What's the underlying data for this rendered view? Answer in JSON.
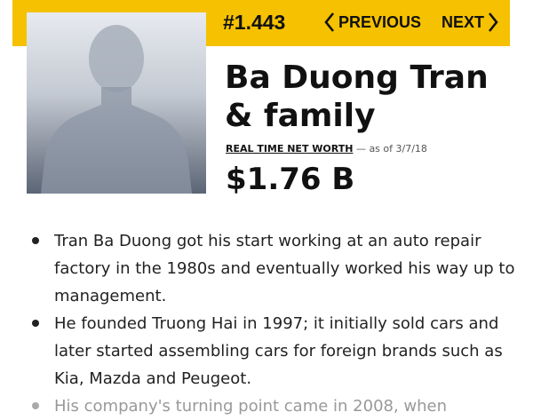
{
  "header": {
    "rank": "#1.443",
    "prev_label": "PREVIOUS",
    "next_label": "NEXT",
    "bar_color": "#f5c100"
  },
  "profile": {
    "name": "Ba Duong Tran & family",
    "net_worth_label": "REAL TIME NET WORTH",
    "net_worth_date": " — as of 3/7/18",
    "net_worth": "$1.76 B",
    "photo_icon": "person-silhouette-icon"
  },
  "facts": [
    "Tran Ba Duong got his start working at an auto repair factory in the 1980s and eventually worked his way up to management.",
    "He founded Truong Hai in 1997; it initially sold cars and later started assembling cars for foreign brands such as Kia, Mazda and Peugeot.",
    "His company's turning point came in 2008, when"
  ]
}
